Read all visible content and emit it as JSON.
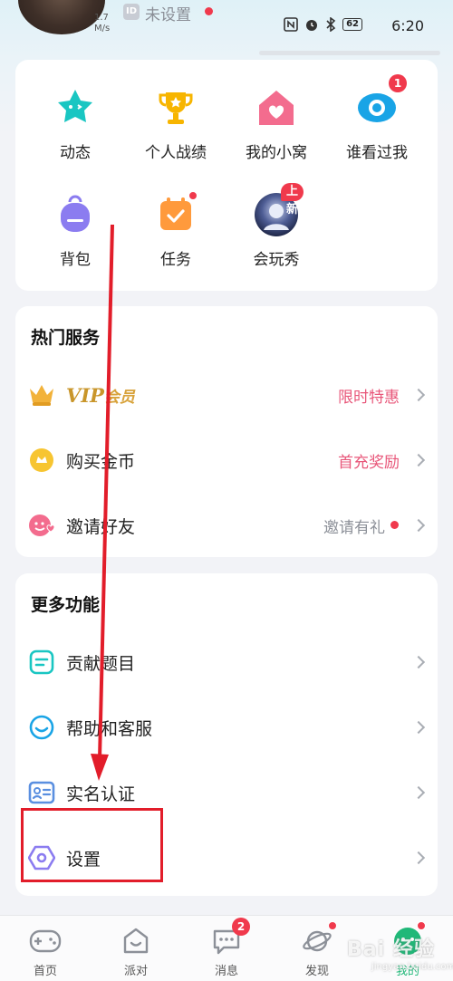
{
  "status_bar": {
    "net_speed_value": "1.7",
    "net_speed_unit": "M/s",
    "id_badge": "ID",
    "profile_name": "未设置",
    "battery": "62",
    "time": "6:20"
  },
  "quick_grid": {
    "items": [
      {
        "label": "动态",
        "icon": "star-face-icon",
        "color": "#19c6c2"
      },
      {
        "label": "个人战绩",
        "icon": "trophy-icon",
        "color": "#f7b500"
      },
      {
        "label": "我的小窝",
        "icon": "home-heart-icon",
        "color": "#f36c8e"
      },
      {
        "label": "谁看过我",
        "icon": "eye-icon",
        "color": "#19a4e6",
        "badge": "1"
      },
      {
        "label": "背包",
        "icon": "backpack-icon",
        "color": "#8b7cf0"
      },
      {
        "label": "任务",
        "icon": "calendar-check-icon",
        "color": "#ff9a3c"
      },
      {
        "label": "会玩秀",
        "icon": "avatar-show-icon",
        "color": "#3a4a7a",
        "tag": "上新"
      }
    ]
  },
  "hot_services": {
    "title": "热门服务",
    "rows": [
      {
        "label_vip": "VIP",
        "label_member": "会员",
        "right": "限时特惠",
        "right_color": "#e8577a"
      },
      {
        "label": "购买金币",
        "right": "首充奖励",
        "right_color": "#e8577a"
      },
      {
        "label": "邀请好友",
        "right": "邀请有礼",
        "right_color": "#8c9098"
      }
    ]
  },
  "more_features": {
    "title": "更多功能",
    "rows": [
      {
        "label": "贡献题目"
      },
      {
        "label": "帮助和客服"
      },
      {
        "label": "实名认证"
      },
      {
        "label": "设置"
      }
    ]
  },
  "bottom_nav": {
    "items": [
      {
        "label": "首页"
      },
      {
        "label": "派对"
      },
      {
        "label": "消息",
        "badge": "2"
      },
      {
        "label": "发现"
      },
      {
        "label": "我的",
        "active": true
      }
    ]
  },
  "watermark": {
    "text": "Bai 经验",
    "sub": "jingyan.baidu.com"
  },
  "colors": {
    "accent_green": "#20b878",
    "badge_red": "#f0394c",
    "annotation_red": "#e21d2a"
  }
}
